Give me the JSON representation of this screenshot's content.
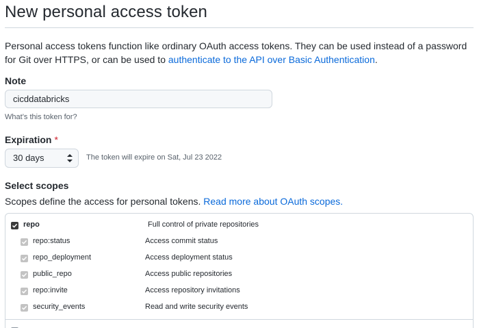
{
  "page": {
    "title": "New personal access token",
    "intro_text": "Personal access tokens function like ordinary OAuth access tokens. They can be used instead of a password for Git over HTTPS, or can be used to ",
    "intro_link": "authenticate to the API over Basic Authentication",
    "intro_end": "."
  },
  "note": {
    "label": "Note",
    "value": "cicddatabricks",
    "hint": "What’s this token for?"
  },
  "expiration": {
    "label": "Expiration",
    "required_mark": "*",
    "selected": "30 days",
    "message": "The token will expire on Sat, Jul 23 2022"
  },
  "scopes": {
    "label": "Select scopes",
    "description": "Scopes define the access for personal tokens. ",
    "link": "Read more about OAuth scopes.",
    "items": [
      {
        "name": "repo",
        "desc": "Full control of private repositories",
        "checked": true
      },
      {
        "name": "repo:status",
        "desc": "Access commit status",
        "checked": true
      },
      {
        "name": "repo_deployment",
        "desc": "Access deployment status",
        "checked": true
      },
      {
        "name": "public_repo",
        "desc": "Access public repositories",
        "checked": true
      },
      {
        "name": "repo:invite",
        "desc": "Access repository invitations",
        "checked": true
      },
      {
        "name": "security_events",
        "desc": "Read and write security events",
        "checked": true
      }
    ]
  },
  "colors": {
    "link": "#0969da",
    "required": "#cf222e",
    "border": "#d0d7de"
  }
}
